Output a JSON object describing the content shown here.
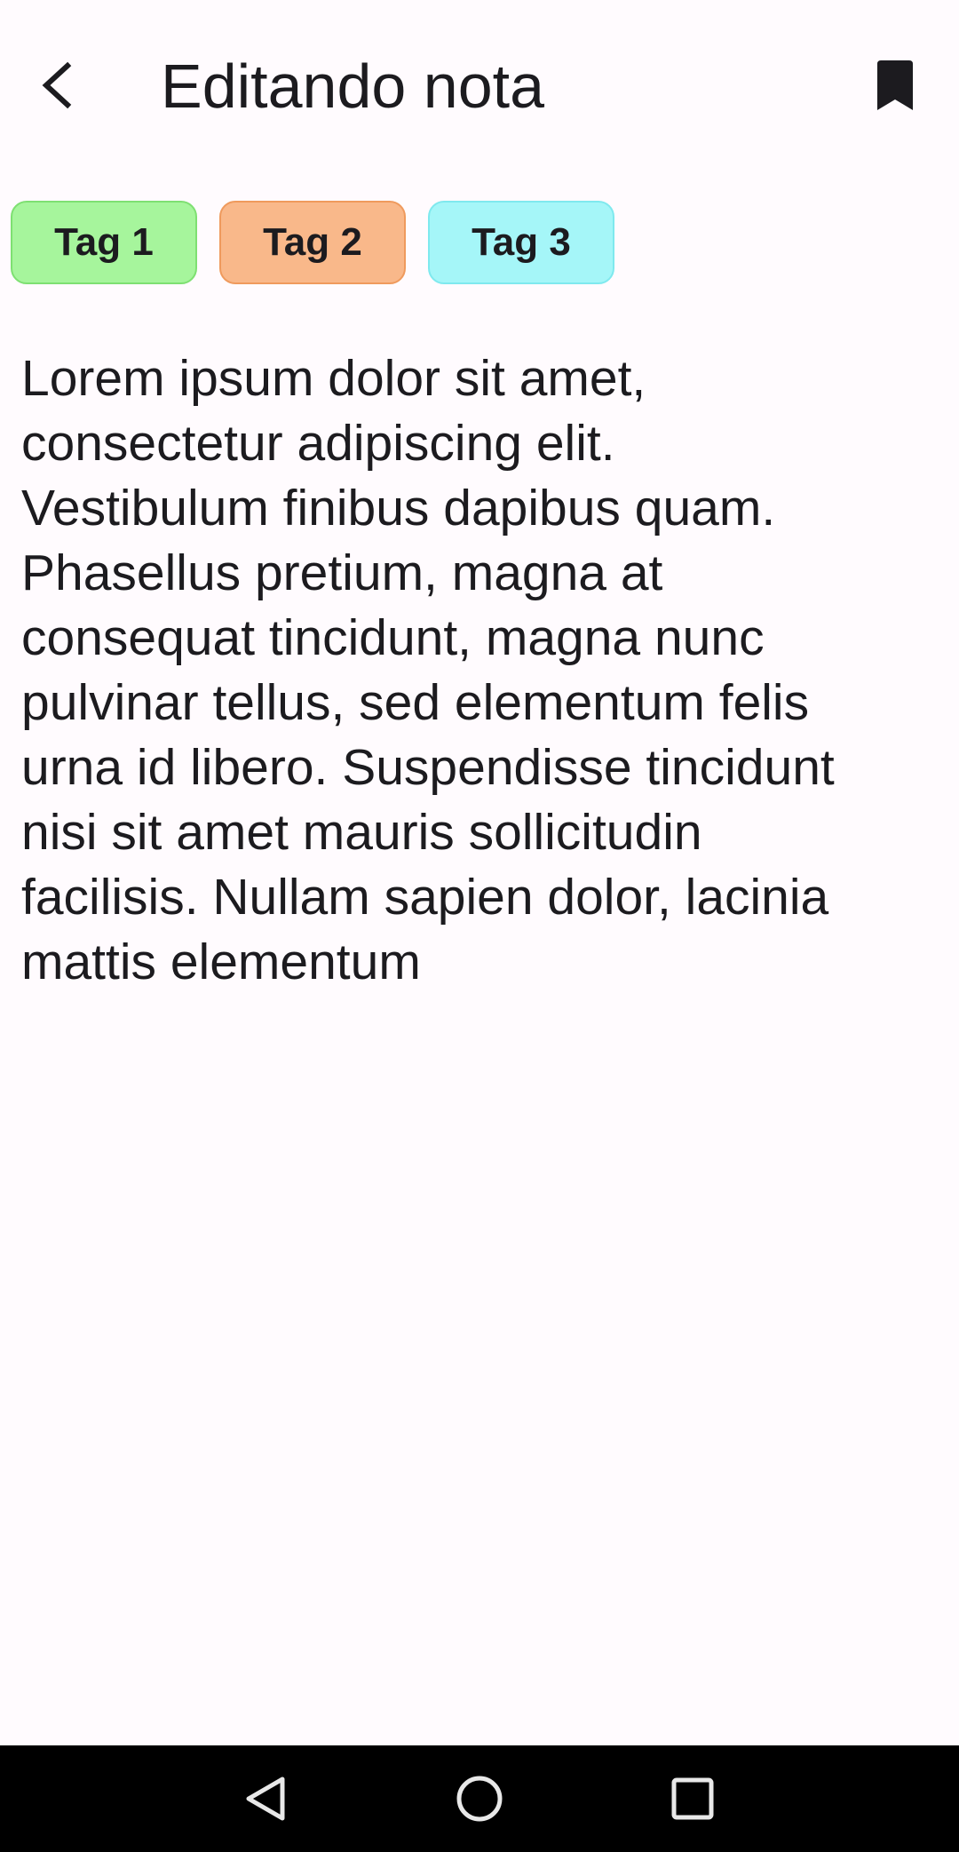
{
  "app_bar": {
    "title": "Editando nota",
    "back_icon": "arrow-back-icon",
    "bookmark_icon": "bookmark-icon"
  },
  "tags": [
    {
      "label": "Tag 1",
      "fill": "#a6f59c",
      "border": "#7ee072"
    },
    {
      "label": "Tag 2",
      "fill": "#f9b88a",
      "border": "#ef9a5d"
    },
    {
      "label": "Tag 3",
      "fill": "#a5f6f8",
      "border": "#7fe9ee"
    }
  ],
  "note": {
    "text": "Lorem ipsum dolor sit amet,\nconsectetur adipiscing elit.\nVestibulum finibus dapibus quam.\nPhasellus pretium, magna at\nconsequat tincidunt, magna nunc\npulvinar tellus, sed elementum felis\nurna id libero. Suspendisse tincidunt\nnisi sit amet mauris sollicitudin\nfacilisis. Nullam sapien dolor, lacinia\nmattis elementum"
  },
  "nav_bar": {
    "back_icon": "triangle-back-icon",
    "home_icon": "circle-home-icon",
    "recents_icon": "square-recents-icon"
  },
  "colors": {
    "background": "#fffbfe",
    "text": "#1c1b1f",
    "nav_bar": "#000000"
  }
}
